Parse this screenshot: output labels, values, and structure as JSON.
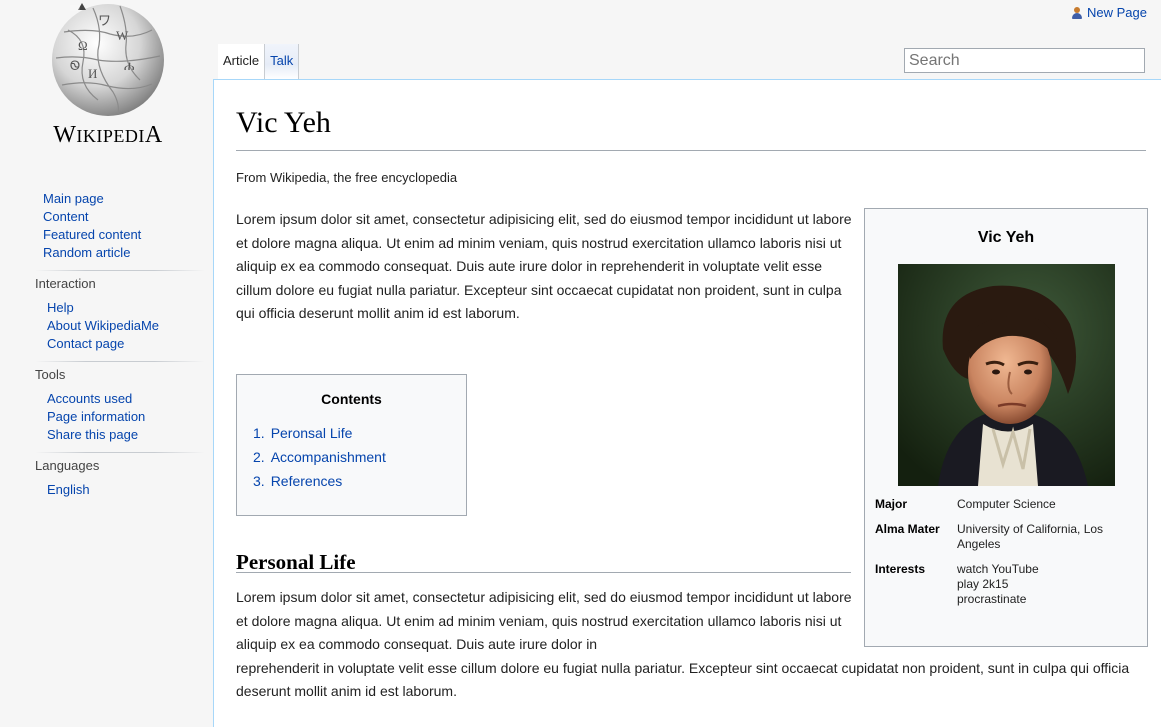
{
  "header": {
    "new_page_label": "New Page",
    "user_icon": "user-icon"
  },
  "logo": {
    "wordmark_W": "W",
    "wordmark_IKIPEDI": "IKIPEDI",
    "wordmark_A": "A"
  },
  "sidebar": {
    "nav": [
      "Main page",
      "Content",
      "Featured content",
      "Random article"
    ],
    "portals": [
      {
        "heading": "Interaction",
        "items": [
          "Help",
          "About WikipediaMe",
          "Contact page"
        ]
      },
      {
        "heading": "Tools",
        "items": [
          "Accounts used",
          "Page information",
          "Share this page"
        ]
      },
      {
        "heading": "Languages",
        "items": [
          "English"
        ]
      }
    ]
  },
  "tabs": {
    "article": "Article",
    "talk": "Talk"
  },
  "search": {
    "placeholder": "Search"
  },
  "article": {
    "title": "Vic Yeh",
    "tagline": "From Wikipedia, the free encyclopedia",
    "intro": "Lorem ipsum dolor sit amet, consectetur adipisicing elit, sed do eiusmod tempor incididunt ut labore et dolore magna aliqua. Ut enim ad minim veniam, quis nostrud exercitation ullamco laboris nisi ut aliquip ex ea commodo consequat. Duis aute irure dolor in reprehenderit in voluptate velit esse cillum dolore eu fugiat nulla pariatur. Excepteur sint occaecat cupidatat non proident, sunt in culpa qui officia deserunt mollit anim id est laborum.",
    "toc": {
      "title": "Contents",
      "items": [
        {
          "num": "1.",
          "label": "Peronsal Life"
        },
        {
          "num": "2.",
          "label": "Accompanishment"
        },
        {
          "num": "3.",
          "label": "References"
        }
      ]
    },
    "section1": {
      "heading": "Personal Life",
      "body_wrapped": "Lorem ipsum dolor sit amet, consectetur adipisicing elit, sed do eiusmod tempor incididunt ut labore et dolore magna aliqua. Ut enim ad minim veniam, quis nostrud exercitation ullamco laboris nisi ut aliquip ex ea commodo consequat. Duis aute irure dolor in",
      "body_rest": "reprehenderit in voluptate velit esse cillum dolore eu fugiat nulla pariatur. Excepteur sint occaecat cupidatat non proident, sunt in culpa qui officia deserunt mollit anim id est laborum."
    }
  },
  "infobox": {
    "title": "Vic Yeh",
    "rows": [
      {
        "label": "Major",
        "value": [
          "Computer Science"
        ]
      },
      {
        "label": "Alma Mater",
        "value": [
          "University of California, Los Angeles"
        ]
      },
      {
        "label": "Interests",
        "value": [
          "watch YouTube",
          "play 2k15",
          "procrastinate"
        ]
      }
    ]
  },
  "colors": {
    "link": "#0645ad",
    "content_border": "#a7d7f9",
    "background": "#f6f6f6"
  }
}
